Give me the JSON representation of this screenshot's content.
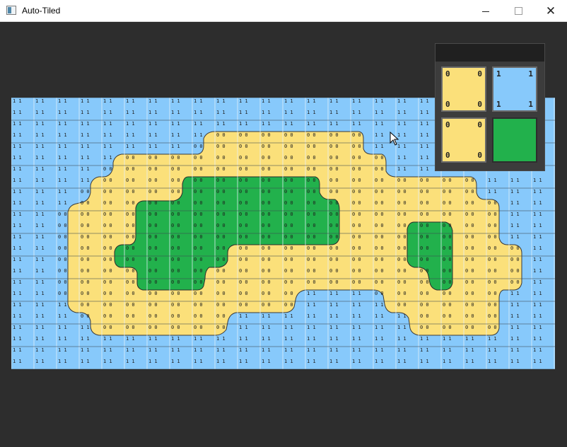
{
  "window": {
    "title": "Auto-Tiled"
  },
  "colors": {
    "water": "#87c9fb",
    "sand": "#fbe07a",
    "grass": "#22b14c",
    "grid": "#5f6f7f",
    "background": "#2d2d2d"
  },
  "palette": {
    "tiles": [
      {
        "name": "sand",
        "color": "#fbe07a",
        "labels": [
          "0",
          "0",
          "0",
          "0"
        ]
      },
      {
        "name": "water",
        "color": "#87c9fb",
        "labels": [
          "1",
          "1",
          "1",
          "1"
        ]
      },
      {
        "name": "sand",
        "color": "#fbe07a",
        "labels": [
          "0",
          "0",
          "0",
          "0"
        ]
      },
      {
        "name": "grass",
        "color": "#22b14c",
        "labels": [
          "",
          "",
          "",
          ""
        ]
      }
    ]
  },
  "tile_markers": {
    "water": "1 1",
    "sand": "0 0"
  }
}
